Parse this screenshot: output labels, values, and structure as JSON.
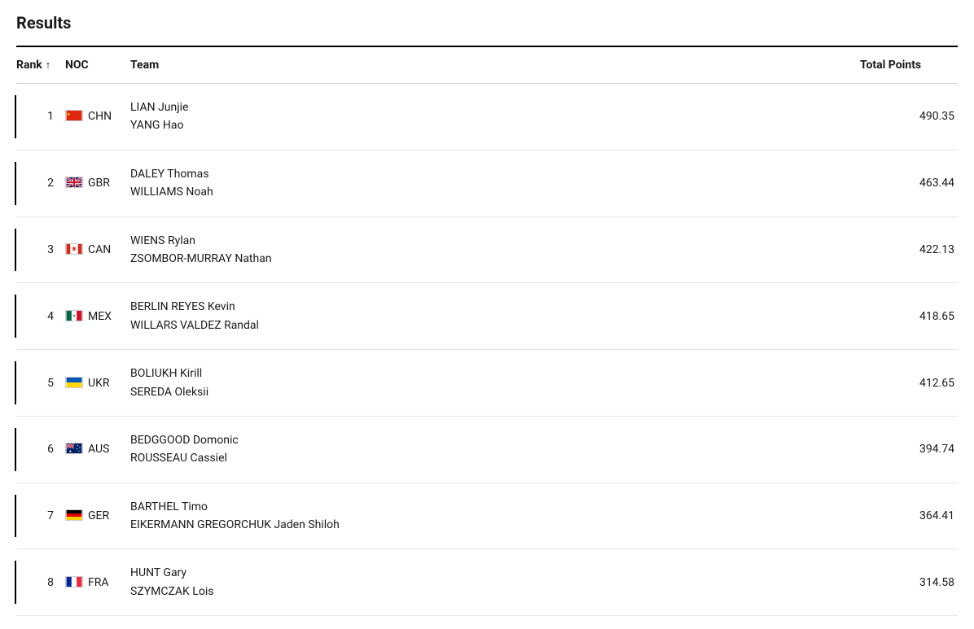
{
  "heading": "Results",
  "columns": {
    "rank": "Rank",
    "noc": "NOC",
    "team": "Team",
    "points": "Total Points"
  },
  "sort_indicator": "↑",
  "rows": [
    {
      "rank": "1",
      "noc": "CHN",
      "flag": "chn",
      "athlete1": "LIAN Junjie",
      "athlete2": "YANG Hao",
      "points": "490.35"
    },
    {
      "rank": "2",
      "noc": "GBR",
      "flag": "gbr",
      "athlete1": "DALEY Thomas",
      "athlete2": "WILLIAMS Noah",
      "points": "463.44"
    },
    {
      "rank": "3",
      "noc": "CAN",
      "flag": "can",
      "athlete1": "WIENS Rylan",
      "athlete2": "ZSOMBOR-MURRAY Nathan",
      "points": "422.13"
    },
    {
      "rank": "4",
      "noc": "MEX",
      "flag": "mex",
      "athlete1": "BERLIN REYES Kevin",
      "athlete2": "WILLARS VALDEZ Randal",
      "points": "418.65"
    },
    {
      "rank": "5",
      "noc": "UKR",
      "flag": "ukr",
      "athlete1": "BOLIUKH Kirill",
      "athlete2": "SEREDA Oleksii",
      "points": "412.65"
    },
    {
      "rank": "6",
      "noc": "AUS",
      "flag": "aus",
      "athlete1": "BEDGGOOD Domonic",
      "athlete2": "ROUSSEAU Cassiel",
      "points": "394.74"
    },
    {
      "rank": "7",
      "noc": "GER",
      "flag": "ger",
      "athlete1": "BARTHEL Timo",
      "athlete2": "EIKERMANN GREGORCHUK Jaden Shiloh",
      "points": "364.41"
    },
    {
      "rank": "8",
      "noc": "FRA",
      "flag": "fra",
      "athlete1": "HUNT Gary",
      "athlete2": "SZYMCZAK Lois",
      "points": "314.58"
    }
  ]
}
